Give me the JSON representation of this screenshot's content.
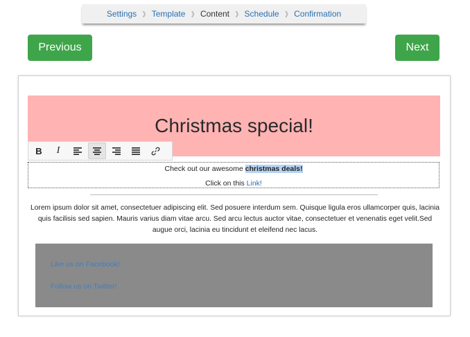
{
  "breadcrumb": {
    "steps": [
      "Settings",
      "Template",
      "Content",
      "Schedule",
      "Confirmation"
    ],
    "active": "Content"
  },
  "nav": {
    "previous_label": "Previous",
    "next_label": "Next",
    "button_color": "#3fa54a"
  },
  "email": {
    "banner_title": "Christmas special!",
    "banner_color": "#ffb3b3",
    "toolbar": {
      "bold": "B",
      "italic": "I",
      "icons": [
        "bold-icon",
        "italic-icon",
        "align-left-icon",
        "align-center-icon",
        "align-right-icon",
        "align-justify-icon",
        "link-icon"
      ],
      "active": "align-center-icon"
    },
    "line1_prefix": "Check out our awesome ",
    "line1_highlight": "christmas deals!",
    "line2_prefix": "Click on this ",
    "line2_link": "Link!",
    "body_text": "Lorem ipsum dolor sit amet, consectetuer adipiscing elit. Sed posuere interdum sem. Quisque ligula eros ullamcorper quis, lacinia quis facilisis sed sapien. Mauris varius diam vitae arcu. Sed arcu lectus auctor vitae, consectetuer et venenatis eget velit.Sed augue orci, lacinia eu tincidunt et eleifend nec lacus.",
    "footer": {
      "facebook_link": "Like us on Facebook!",
      "twitter_link": "Follow us on Twitter!",
      "background": "#8a8a8a"
    }
  }
}
